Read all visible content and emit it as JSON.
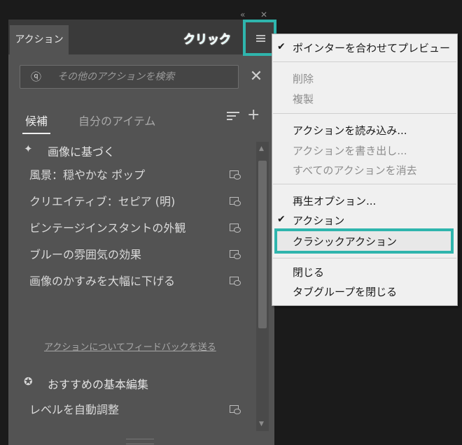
{
  "panel": {
    "tab_label": "アクション",
    "search_placeholder": "その他のアクションを検索",
    "subtabs": {
      "active": "候補",
      "inactive": "自分のアイテム"
    },
    "sections": [
      {
        "title": "画像に基づく",
        "icon": "sparkle-icon",
        "items": [
          "風景：穏やかな ポップ",
          "クリエイティブ：セピア (明)",
          "ビンテージインスタントの外観",
          "ブルーの雰囲気の効果",
          "画像のかすみを大幅に下げる"
        ]
      },
      {
        "title": "おすすめの基本編集",
        "icon": "badge-icon",
        "items": [
          "レベルを自動調整"
        ]
      }
    ],
    "feedback_link": "アクションについてフィードバックを送る"
  },
  "callout": "クリック",
  "menu": {
    "items": [
      {
        "label": "ポインターを合わせてプレビュー",
        "checked": true,
        "disabled": false
      },
      {
        "label": "削除",
        "checked": false,
        "disabled": true
      },
      {
        "label": "複製",
        "checked": false,
        "disabled": true
      },
      {
        "label": "アクションを読み込み...",
        "checked": false,
        "disabled": false
      },
      {
        "label": "アクションを書き出し...",
        "checked": false,
        "disabled": true
      },
      {
        "label": "すべてのアクションを消去",
        "checked": false,
        "disabled": true
      },
      {
        "label": "再生オプション...",
        "checked": false,
        "disabled": false
      },
      {
        "label": "アクション",
        "checked": true,
        "disabled": false
      },
      {
        "label": "クラシックアクション",
        "checked": false,
        "disabled": false,
        "highlighted": true
      },
      {
        "label": "閉じる",
        "checked": false,
        "disabled": false
      },
      {
        "label": "タブグループを閉じる",
        "checked": false,
        "disabled": false
      }
    ]
  },
  "colors": {
    "highlight": "#2fb5ad",
    "panel_bg": "#535353",
    "menu_bg": "#f0f0f0"
  }
}
